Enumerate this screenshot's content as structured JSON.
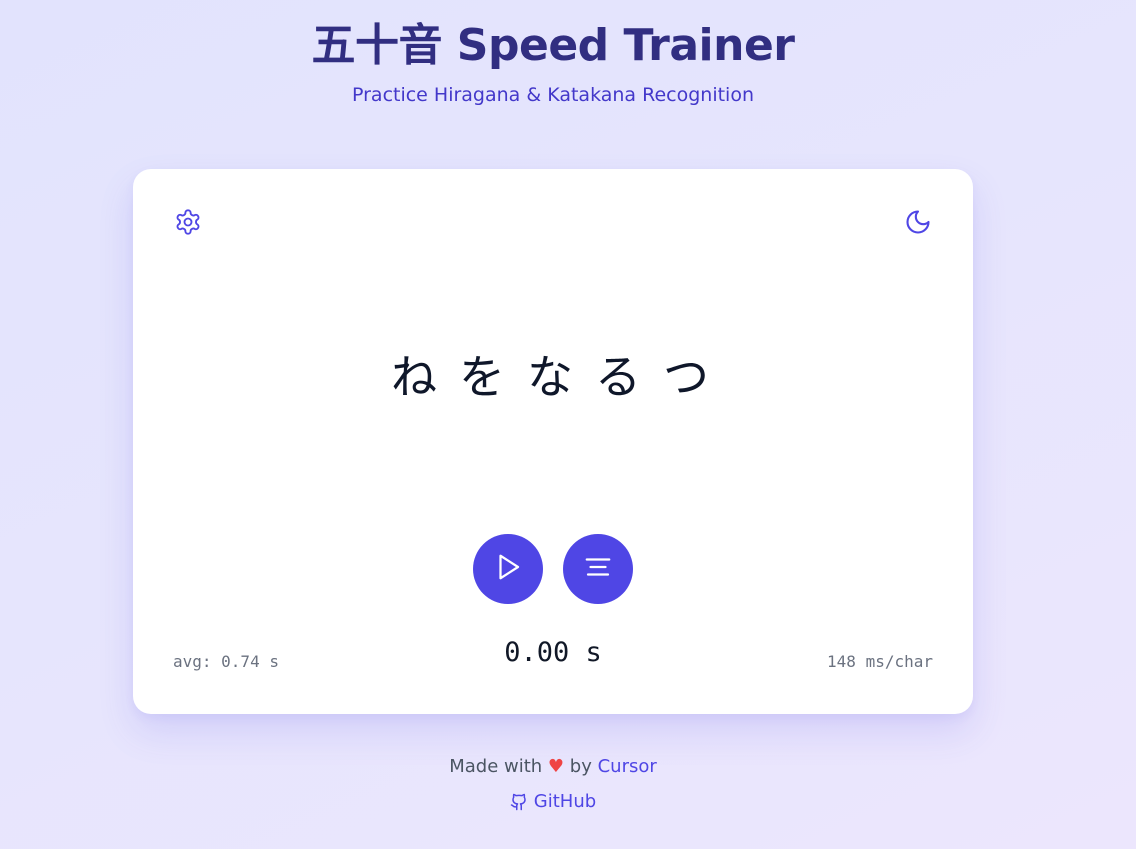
{
  "header": {
    "title": "五十音 Speed Trainer",
    "subtitle": "Practice Hiragana & Katakana Recognition"
  },
  "card": {
    "settings_icon": "gear-icon",
    "theme_icon": "moon-icon",
    "kana": [
      "ね",
      "を",
      "な",
      "る",
      "つ"
    ],
    "play_icon": "play-icon",
    "menu_icon": "menu-icon",
    "avg": "avg: 0.74 s",
    "timer": "0.00 s",
    "speed": "148 ms/char"
  },
  "footer": {
    "made_with": "Made with",
    "heart": "♥",
    "by": "by",
    "cursor_link": "Cursor",
    "github_icon": "github-icon",
    "github_link": "GitHub"
  },
  "colors": {
    "accent": "#4f46e5",
    "title": "#312e81",
    "subtitle": "#4338ca",
    "heart": "#ef4444"
  }
}
